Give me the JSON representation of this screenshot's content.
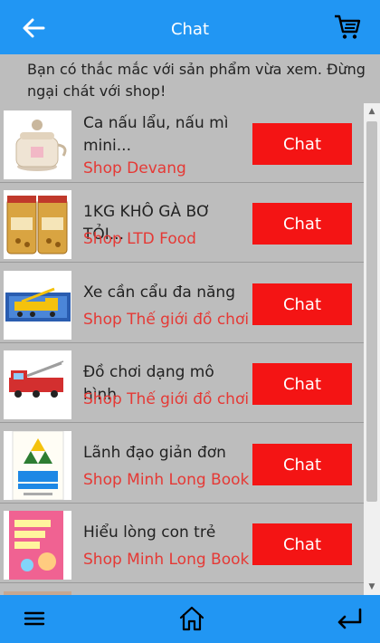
{
  "header": {
    "title": "Chat",
    "back_icon": "arrow-left-icon",
    "cart_icon": "shopping-cart-icon",
    "background": "#2196F3"
  },
  "notice": {
    "text": "Bạn có thắc mắc với sản phẩm vừa xem. Đừng ngại chát với shop!"
  },
  "products": [
    {
      "name": "Ca nấu lẩu, nấu mì\nmini...",
      "shop": "Shop Devang",
      "button": "Chat"
    },
    {
      "name": "1KG KHÔ GÀ BƠ TỎI...",
      "shop": "Shop LTD Food",
      "button": "Chat"
    },
    {
      "name": "Xe cần cẩu đa năng",
      "shop": "Shop Thế giới đồ chơi",
      "button": "Chat"
    },
    {
      "name": "Đồ chơi dạng mô hình",
      "shop": "Shop Thế giới đồ chơi",
      "button": "Chat"
    },
    {
      "name": "Lãnh đạo giản đơn",
      "shop": "Shop Minh Long Book",
      "button": "Chat"
    },
    {
      "name": "Hiểu lòng con trẻ",
      "shop": "Shop Minh Long Book",
      "button": "Chat"
    }
  ],
  "bottom_nav": {
    "menu_icon": "hamburger-menu-icon",
    "home_icon": "home-icon",
    "return_icon": "return-arrow-icon"
  },
  "colors": {
    "accent": "#2196F3",
    "chat_button": "#f41414",
    "shop_text": "#e53935",
    "list_background": "#BDBDBD"
  }
}
